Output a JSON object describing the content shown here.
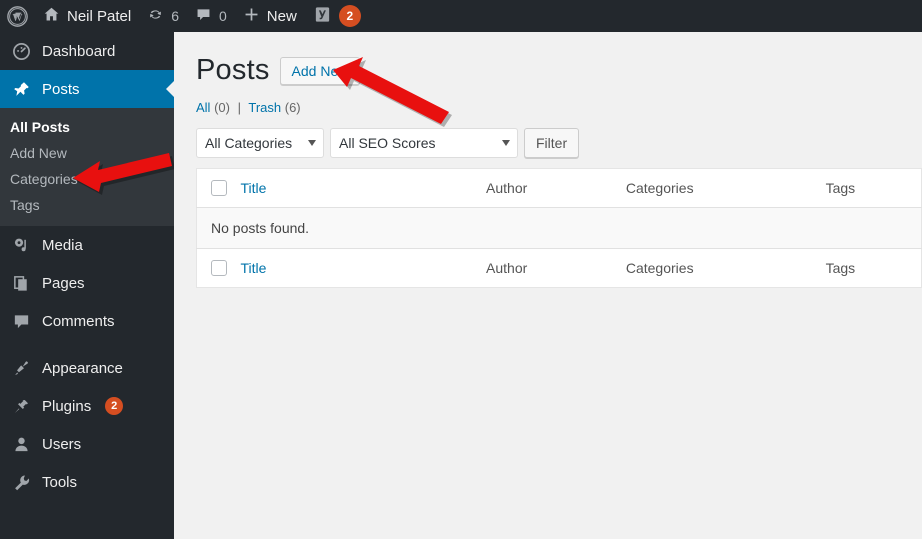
{
  "adminbar": {
    "logo_icon": "wordpress-logo-icon",
    "site": {
      "icon": "home-icon",
      "label": "Neil Patel"
    },
    "updates": {
      "icon": "updates-icon",
      "count": "6"
    },
    "comments": {
      "icon": "comment-bubble-icon",
      "count": "0"
    },
    "new": {
      "icon": "plus-icon",
      "label": "New"
    },
    "yoast": {
      "icon": "yoast-seo-icon",
      "badge": "2"
    }
  },
  "sidebar": {
    "items": [
      {
        "label": "Dashboard",
        "icon": "dashboard-icon",
        "current": false
      },
      {
        "label": "Posts",
        "icon": "pin-icon",
        "current": true
      },
      {
        "label": "Media",
        "icon": "media-icon",
        "current": false
      },
      {
        "label": "Pages",
        "icon": "pages-icon",
        "current": false
      },
      {
        "label": "Comments",
        "icon": "comment-bubble-icon",
        "current": false
      },
      {
        "label": "Appearance",
        "icon": "paintbrush-icon",
        "current": false
      },
      {
        "label": "Plugins",
        "icon": "plug-icon",
        "current": false,
        "badge": "2"
      },
      {
        "label": "Users",
        "icon": "user-icon",
        "current": false
      },
      {
        "label": "Tools",
        "icon": "wrench-icon",
        "current": false
      }
    ],
    "submenu": [
      {
        "label": "All Posts",
        "current": true
      },
      {
        "label": "Add New",
        "current": false
      },
      {
        "label": "Categories",
        "current": false
      },
      {
        "label": "Tags",
        "current": false
      }
    ]
  },
  "main": {
    "page_title": "Posts",
    "add_new_label": "Add New",
    "views": {
      "all_label": "All",
      "all_count": "(0)",
      "separator": "|",
      "trash_label": "Trash",
      "trash_count": "(6)"
    },
    "tablenav": {
      "category_filter": "All Categories",
      "seo_filter": "All SEO Scores",
      "filter_button": "Filter"
    },
    "table": {
      "columns": {
        "title": "Title",
        "author": "Author",
        "categories": "Categories",
        "tags": "Tags"
      },
      "empty_message": "No posts found."
    }
  },
  "annotations": {
    "arrow_color": "#e8100f",
    "arrow_add_new": "arrow-pointing-to-add-new-button",
    "arrow_sidebar_add_new": "arrow-pointing-to-sidebar-add-new"
  },
  "colors": {
    "admin_bar": "#23282d",
    "sidebar": "#23282d",
    "submenu": "#32373c",
    "accent_blue": "#0073aa",
    "badge_orange": "#d54e21",
    "content_bg": "#f1f1f1"
  }
}
